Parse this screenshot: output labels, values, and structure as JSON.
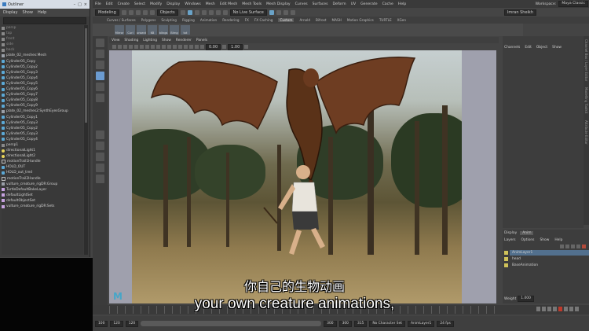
{
  "outliner": {
    "title": "Outliner",
    "menus": [
      "Display",
      "Show",
      "Help"
    ],
    "items": [
      {
        "label": "persp",
        "icon": "cam",
        "dim": true
      },
      {
        "label": "top",
        "icon": "cam",
        "dim": true
      },
      {
        "label": "front",
        "icon": "cam",
        "dim": true
      },
      {
        "label": "side",
        "icon": "cam",
        "dim": true
      },
      {
        "label": "back",
        "icon": "cam",
        "dim": true
      },
      {
        "label": "plate_02_meshes:Mesh",
        "icon": "grp"
      },
      {
        "label": "Cylinder05_Copy",
        "icon": "mesh"
      },
      {
        "label": "Cylinder05_Copy2",
        "icon": "mesh"
      },
      {
        "label": "Cylinder05_Copy3",
        "icon": "mesh"
      },
      {
        "label": "Cylinder05_Copy4",
        "icon": "mesh"
      },
      {
        "label": "Cylinder05_Copy5",
        "icon": "mesh"
      },
      {
        "label": "Cylinder05_Copy6",
        "icon": "mesh"
      },
      {
        "label": "Cylinder05_Copy7",
        "icon": "mesh"
      },
      {
        "label": "Cylinder05_Copy8",
        "icon": "mesh"
      },
      {
        "label": "Cylinder05_Copy9",
        "icon": "mesh"
      },
      {
        "label": "plate_02_meshes2:SynthEyesGroup",
        "icon": "grp"
      },
      {
        "label": "Cylinder05_Copy1",
        "icon": "mesh"
      },
      {
        "label": "Cylinder05_Copy3",
        "icon": "mesh"
      },
      {
        "label": "Cylinder05_Copy2",
        "icon": "mesh"
      },
      {
        "label": "Cylinder05_Copy3",
        "icon": "mesh"
      },
      {
        "label": "Cylinder05_Copy4",
        "icon": "mesh"
      },
      {
        "label": "persp1",
        "icon": "cam"
      },
      {
        "label": "directionalLight1",
        "icon": "light"
      },
      {
        "label": "directionalLight2",
        "icon": "light"
      },
      {
        "label": "motionTrail1Handle",
        "icon": "loc"
      },
      {
        "label": "HOLD_OUT",
        "icon": "mesh"
      },
      {
        "label": "HOLD_out_tred",
        "icon": "mesh"
      },
      {
        "label": "motionTrail2Handle",
        "icon": "loc"
      },
      {
        "label": "vulture_creature_rigDR:Group",
        "icon": "grp"
      },
      {
        "label": "TurtleDefaultBakeLayer",
        "icon": "set"
      },
      {
        "label": "defaultLightSet",
        "icon": "set"
      },
      {
        "label": "defaultObjectSet",
        "icon": "set"
      },
      {
        "label": "vulture_creature_rigDR:Sets",
        "icon": "set"
      }
    ]
  },
  "menubar": {
    "items": [
      "File",
      "Edit",
      "Create",
      "Select",
      "Modify",
      "Display",
      "Windows",
      "Mesh",
      "Edit Mesh",
      "Mesh Tools",
      "Mesh Display",
      "Curves",
      "Surfaces",
      "Deform",
      "UV",
      "Generate",
      "Cache",
      "Help"
    ],
    "workspace_label": "Workspace:",
    "workspace_value": "Maya Classic"
  },
  "statusline": {
    "mode": "Modeling",
    "objects": "Objects",
    "live_surface": "No Live Surface",
    "user": "Imran Sheikh"
  },
  "shelf": {
    "tabs": [
      "Curves / Surfaces",
      "Polygons",
      "Sculpting",
      "Rigging",
      "Animation",
      "Rendering",
      "FX",
      "FX Caching",
      "Custom",
      "Arnold",
      "Bifrost",
      "MASH",
      "Motion Graphics",
      "TURTLE",
      "XGen"
    ],
    "active_tab": "Custom",
    "icons": [
      "Mirror",
      "Curl",
      "unsecti",
      "KB",
      "bllngs",
      "Blrng",
      "txt"
    ]
  },
  "panel": {
    "menus": [
      "View",
      "Shading",
      "Lighting",
      "Show",
      "Renderer",
      "Panels"
    ],
    "field_a": "0.00",
    "field_b": "1.00"
  },
  "channelbox": {
    "tabs": [
      "Channel Box / Layer Editor"
    ],
    "menus": [
      "Channels",
      "Edit",
      "Object",
      "Show"
    ]
  },
  "side_tabs": [
    "Channel Box / Layer Editor",
    "Modelling Toolkit",
    "Attribute Editor"
  ],
  "layers": {
    "tabs": [
      "Display",
      "Anim"
    ],
    "active_tab": "Anim",
    "menus": [
      "Layers",
      "Options",
      "Show",
      "Help"
    ],
    "rows": [
      {
        "name": "AnimLayer1",
        "selected": true
      },
      {
        "name": "head",
        "selected": false
      },
      {
        "name": "BaseAnimation",
        "selected": false
      }
    ],
    "weight_label": "Weight",
    "weight_value": "1.000"
  },
  "range": {
    "start": "100",
    "start_inner": "120",
    "end_inner": "300",
    "end": "315",
    "char_set": "No Character Set",
    "anim_layer": "AnimLayer1",
    "fps": "24 fps",
    "current_a": "120",
    "current_b": "300"
  },
  "subtitles": {
    "zh": "你自己的生物动画",
    "en": "your own creature animations,"
  },
  "colors": {
    "accent": "#52708e",
    "maya_blue": "#46a6c8"
  }
}
